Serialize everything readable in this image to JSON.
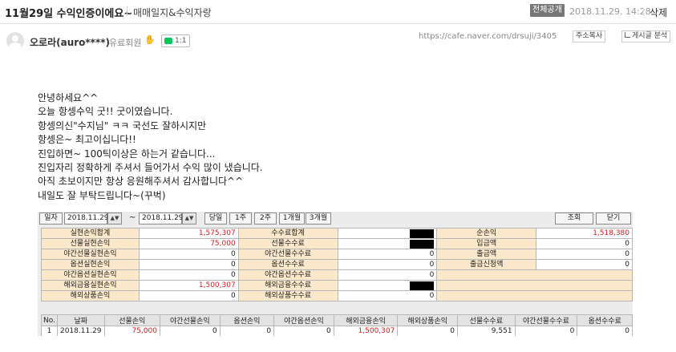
{
  "header": {
    "title": "11월29일 수익인증이에요~",
    "board": "매매일지&수익자랑",
    "visibility": "전체공개",
    "date": "2018.11.29. 14:28",
    "delete": "삭제"
  },
  "author": {
    "name": "오로라(auro****)",
    "grade": "유료회원",
    "chat_count": "1:1",
    "url": "https://cafe.naver.com/drsuji/3405",
    "copy_url": "주소복사",
    "stats": "게시글 분석"
  },
  "body": {
    "lines": [
      "안녕하세요^^",
      "오늘 항셍수익 굿!! 굿이였습니다.",
      "항셍의신\"수지님\" ㅋㅋ 국선도 잘하시지만",
      "항셍은~ 최고이십니다!!",
      "진입하면~ 100틱이상은 하는거 같습니다...",
      "진입자리 정확하게 주셔서 들어가서 수익 많이 냈습니다.",
      "아직 초보이지만 항상 응원해주셔서 감사합니다^^",
      "내일도 잘 부탁드립니다~(꾸벅)"
    ]
  },
  "app": {
    "toolbar": {
      "date_label": "일자",
      "date_from": "2018.11.29",
      "tilde": "~",
      "date_to": "2018.11.29",
      "spin": "▲▼",
      "btn_today": "당일",
      "btn_1w": "1주",
      "btn_2w": "2주",
      "btn_1m": "1개월",
      "btn_3m": "3개월",
      "btn_query": "조회",
      "btn_close": "닫기"
    },
    "summary": [
      [
        "실현손익합계",
        "1,575,307",
        "수수료합계",
        "",
        "순손익",
        "1,518,380"
      ],
      [
        "선물실현손익",
        "75,000",
        "선물수수료",
        "",
        "입금액",
        "0"
      ],
      [
        "야간선물실현손익",
        "0",
        "야간선물수수료",
        "0",
        "출금액",
        "0"
      ],
      [
        "옵션실현손익",
        "0",
        "옵션수수료",
        "0",
        "출금신청액",
        "0"
      ],
      [
        "야간옵션실현손익",
        "0",
        "야간옵션수수료",
        "0",
        "",
        ""
      ],
      [
        "해외금융실현손익",
        "1,500,307",
        "해외금융수수료",
        "",
        "",
        ""
      ],
      [
        "해외상품손익",
        "0",
        "해외상품수수료",
        "0",
        "",
        ""
      ]
    ],
    "detail": {
      "headers": [
        "No.",
        "날짜",
        "선물손익",
        "야간선물손익",
        "옵션손익",
        "야간옵션손익",
        "해외금융손익",
        "해외상품손익",
        "선물수수료",
        "야간선물수수료",
        "옵션수수료"
      ],
      "rows": [
        [
          "1",
          "2018.11.29",
          "75,000",
          "0",
          "0",
          "0",
          "1,500,307",
          "0",
          "9,551",
          "0",
          "0"
        ]
      ]
    }
  }
}
